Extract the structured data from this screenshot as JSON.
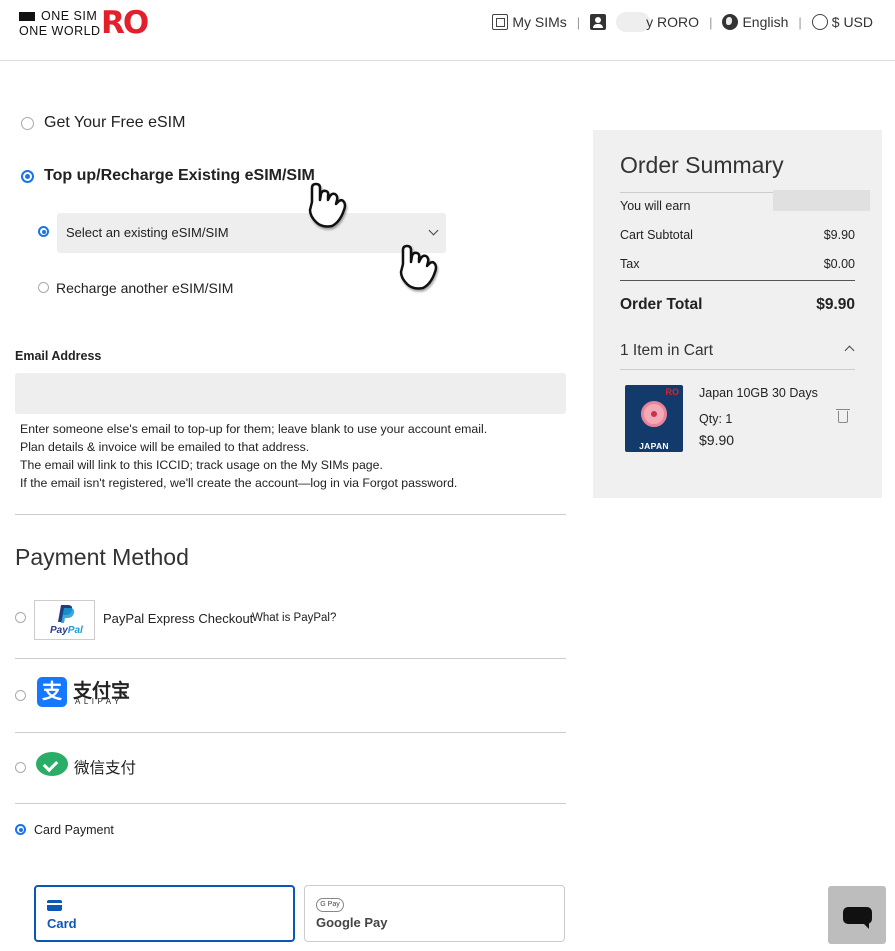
{
  "header": {
    "logo_line1": "ONE SIM",
    "logo_line2": "ONE WORLD",
    "logo_mark": "RO",
    "nav": {
      "my_sims": "My SIMs",
      "account": "y RORO",
      "language": "English",
      "currency": "$ USD"
    },
    "icons": [
      "sim-icon",
      "user-icon",
      "globe-icon",
      "currency-icon"
    ]
  },
  "sim_options": {
    "free_esim": "Get Your Free eSIM",
    "topup": "Top up/Recharge Existing eSIM/SIM",
    "select_existing": "Select an existing eSIM/SIM",
    "select_placeholder": "Select an existing eSIM/SIM",
    "recharge_another": "Recharge another eSIM/SIM",
    "selected": "topup",
    "sub_selected": "select_existing"
  },
  "email": {
    "label": "Email Address",
    "value": "",
    "help": [
      "Enter someone else's email to top-up for them; leave blank to use your account email.",
      "Plan details & invoice will be emailed to that address.",
      "The email will link to this ICCID; track usage on the My SIMs page.",
      "If the email isn't registered, we'll create the account—log in via Forgot password."
    ]
  },
  "payment": {
    "title": "Payment Method",
    "paypal_label": "PayPal Express Checkout",
    "paypal_link": "What is PayPal?",
    "paypal_logo_a": "Pay",
    "paypal_logo_b": "Pal",
    "alipay_cn": "支付宝",
    "alipay_en": "ALIPAY",
    "alipay_mark": "支",
    "wechat_cn": "微信支付",
    "card_label": "Card Payment",
    "selected": "card",
    "tabs": [
      {
        "label": "Card",
        "active": true
      },
      {
        "label": "Google Pay",
        "active": false
      }
    ],
    "gpay_badge": "G Pay"
  },
  "summary": {
    "title": "Order Summary",
    "you_will_earn_label": "You will earn",
    "subtotal_label": "Cart Subtotal",
    "subtotal_value": "$9.90",
    "tax_label": "Tax",
    "tax_value": "$0.00",
    "total_label": "Order Total",
    "total_value": "$9.90",
    "items_title": "1 Item in Cart",
    "item": {
      "name": "Japan 10GB 30 Days",
      "qty": "Qty: 1",
      "price": "$9.90",
      "image_brand": "RO",
      "image_label": "JAPAN"
    }
  },
  "colors": {
    "brand_red": "#e21f2b",
    "accent_blue": "#1a73e8",
    "tab_blue": "#0c57b5",
    "summary_bg": "#f0f0f0"
  }
}
